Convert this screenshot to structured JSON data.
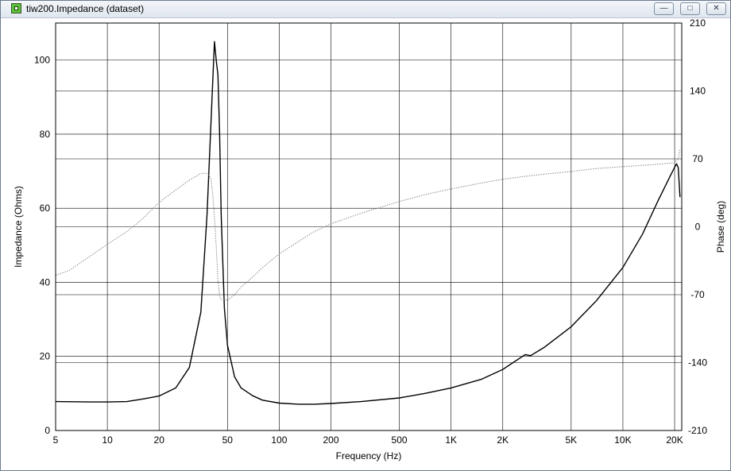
{
  "window": {
    "title": "tiw200.Impedance (dataset)",
    "icon": "app-icon",
    "buttons": {
      "minimize_icon": "minimize-icon",
      "maximize_icon": "maximize-icon",
      "close_icon": "close-icon"
    }
  },
  "colors": {
    "impedance": "#000000",
    "phase": "#888888",
    "grid": "#000000",
    "titlebar": "#dfe6ee"
  },
  "chart_data": {
    "type": "line",
    "title": "",
    "xlabel": "Frequency (Hz)",
    "ylabel": "Impedance (Ohms)",
    "y2label": "Phase (deg)",
    "xscale": "log",
    "xlim": [
      5,
      22000
    ],
    "ylim": [
      0,
      110
    ],
    "y2lim": [
      -210,
      210
    ],
    "grid": true,
    "x_ticks": [
      {
        "value": 5,
        "label": "5"
      },
      {
        "value": 10,
        "label": "10"
      },
      {
        "value": 20,
        "label": "20"
      },
      {
        "value": 50,
        "label": "50"
      },
      {
        "value": 100,
        "label": "100"
      },
      {
        "value": 200,
        "label": "200"
      },
      {
        "value": 500,
        "label": "500"
      },
      {
        "value": 1000,
        "label": "1K"
      },
      {
        "value": 2000,
        "label": "2K"
      },
      {
        "value": 5000,
        "label": "5K"
      },
      {
        "value": 10000,
        "label": "10K"
      },
      {
        "value": 20000,
        "label": "20K"
      }
    ],
    "y_ticks": [
      {
        "value": 0,
        "label": "0"
      },
      {
        "value": 20,
        "label": "20"
      },
      {
        "value": 40,
        "label": "40"
      },
      {
        "value": 60,
        "label": "60"
      },
      {
        "value": 80,
        "label": "80"
      },
      {
        "value": 100,
        "label": "100"
      }
    ],
    "y2_ticks": [
      {
        "value": -210,
        "label": "-210"
      },
      {
        "value": -140,
        "label": "-140"
      },
      {
        "value": -70,
        "label": "-70"
      },
      {
        "value": 0,
        "label": "0"
      },
      {
        "value": 70,
        "label": "70"
      },
      {
        "value": 140,
        "label": "140"
      },
      {
        "value": 210,
        "label": "210"
      }
    ],
    "series": [
      {
        "axis": "left",
        "style": "solid",
        "x": [
          5,
          8,
          10,
          13,
          16,
          17,
          20,
          25,
          30,
          35,
          38,
          40,
          42,
          43,
          44,
          45,
          46,
          48,
          50,
          55,
          60,
          70,
          80,
          100,
          130,
          160,
          200,
          300,
          500,
          700,
          1000,
          1500,
          2000,
          2700,
          2900,
          3500,
          5000,
          7000,
          10000,
          13000,
          16000,
          19000,
          20500,
          21000,
          21500
        ],
        "values": [
          7.8,
          7.7,
          7.7,
          7.8,
          8.5,
          8.7,
          9.3,
          11.5,
          17,
          32,
          58,
          82,
          105,
          100,
          96,
          80,
          58,
          33,
          23,
          14.5,
          11.5,
          9.4,
          8.2,
          7.4,
          7.1,
          7.1,
          7.3,
          7.8,
          8.8,
          10,
          11.5,
          13.8,
          16.5,
          20.5,
          20.2,
          22.5,
          28,
          35,
          44,
          53,
          62,
          69,
          72,
          71,
          63
        ]
      },
      {
        "axis": "right",
        "style": "dotted",
        "x": [
          5,
          6,
          8,
          10,
          13,
          16,
          20,
          25,
          30,
          35,
          38,
          40,
          41,
          42,
          43,
          44,
          45,
          46,
          48,
          50,
          55,
          60,
          70,
          80,
          100,
          130,
          160,
          200,
          300,
          500,
          700,
          1000,
          1500,
          2000,
          3000,
          5000,
          7000,
          10000,
          15000,
          20000,
          21000,
          21500
        ],
        "values": [
          -50,
          -45,
          -30,
          -18,
          -5,
          8,
          25,
          38,
          48,
          55,
          55,
          50,
          35,
          10,
          -20,
          -55,
          -72,
          -75,
          -75,
          -76,
          -70,
          -62,
          -52,
          -42,
          -28,
          -15,
          -5,
          3,
          14,
          26,
          33,
          39,
          45,
          49,
          53,
          57,
          60,
          62,
          64,
          66,
          70,
          80
        ]
      }
    ]
  }
}
